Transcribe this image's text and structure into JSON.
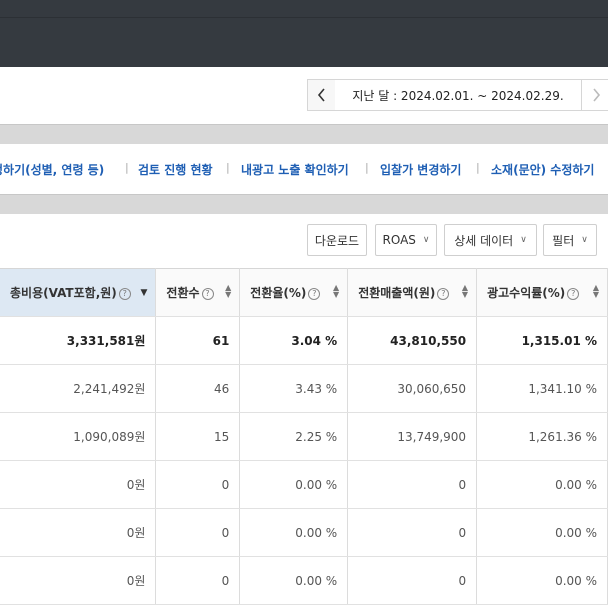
{
  "date_nav": {
    "range_label": "지난 달 : 2024.02.01. ~ 2024.02.29.",
    "prev_icon": "chevron-left-icon",
    "next_icon": "chevron-right-icon"
  },
  "links": [
    "정하기(성별, 연령 등)",
    "검토 진행 현황",
    "내광고 노출 확인하기",
    "입찰가 변경하기",
    "소재(문안) 수정하기"
  ],
  "toolbar": {
    "download": "다운로드",
    "metric": "ROAS",
    "detail": "상세 데이터",
    "filter": "필터"
  },
  "table": {
    "headers": [
      "총비용(VAT포함,원)",
      "전환수",
      "전환율(%)",
      "전환매출액(원)",
      "광고수익률(%)"
    ],
    "rows": [
      [
        "3,331,581원",
        "61",
        "3.04 %",
        "43,810,550",
        "1,315.01 %"
      ],
      [
        "2,241,492원",
        "46",
        "3.43 %",
        "30,060,650",
        "1,341.10 %"
      ],
      [
        "1,090,089원",
        "15",
        "2.25 %",
        "13,749,900",
        "1,261.36 %"
      ],
      [
        "0원",
        "0",
        "0.00 %",
        "0",
        "0.00 %"
      ],
      [
        "0원",
        "0",
        "0.00 %",
        "0",
        "0.00 %"
      ],
      [
        "0원",
        "0",
        "0.00 %",
        "0",
        "0.00 %"
      ]
    ]
  }
}
